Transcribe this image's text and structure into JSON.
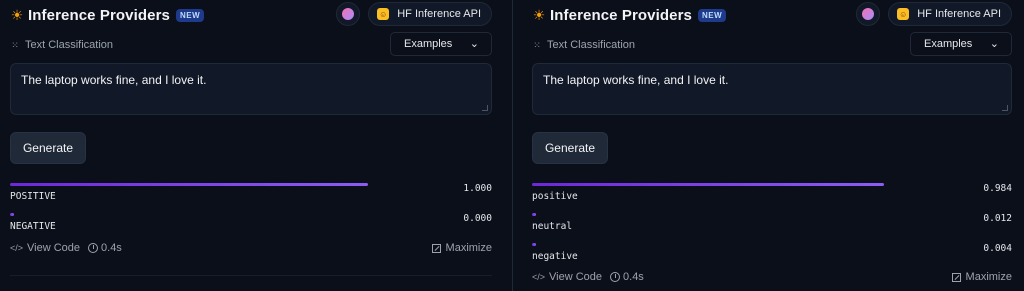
{
  "panels": [
    {
      "title": "Inference Providers",
      "badge": "NEW",
      "provider_label": "HF Inference API",
      "task_label": "Text Classification",
      "examples_label": "Examples",
      "input_text": "The laptop works fine, and I love it.",
      "generate_label": "Generate",
      "results": [
        {
          "label": "POSITIVE",
          "value": "1.000",
          "score": 1.0
        },
        {
          "label": "NEGATIVE",
          "value": "0.000",
          "score": 0.0
        }
      ],
      "view_code_label": "View Code",
      "time_label": "0.4s",
      "maximize_label": "Maximize"
    },
    {
      "title": "Inference Providers",
      "badge": "NEW",
      "provider_label": "HF Inference API",
      "task_label": "Text Classification",
      "examples_label": "Examples",
      "input_text": "The laptop works fine, and I love it.",
      "generate_label": "Generate",
      "results": [
        {
          "label": "positive",
          "value": "0.984",
          "score": 0.984
        },
        {
          "label": "neutral",
          "value": "0.012",
          "score": 0.012
        },
        {
          "label": "negative",
          "value": "0.004",
          "score": 0.004
        }
      ],
      "view_code_label": "View Code",
      "time_label": "0.4s",
      "maximize_label": "Maximize"
    }
  ],
  "colors": {
    "bar_start": "#6d28d9",
    "bar_end": "#8b5cf6",
    "badge_bg": "#1e3a8a",
    "background": "#0b0f19"
  },
  "icons": {
    "title": "sun-icon",
    "task": "grid-dots-icon",
    "examples": "chevron-down-icon",
    "view_code": "code-icon",
    "time": "clock-icon",
    "maximize": "maximize-icon"
  }
}
